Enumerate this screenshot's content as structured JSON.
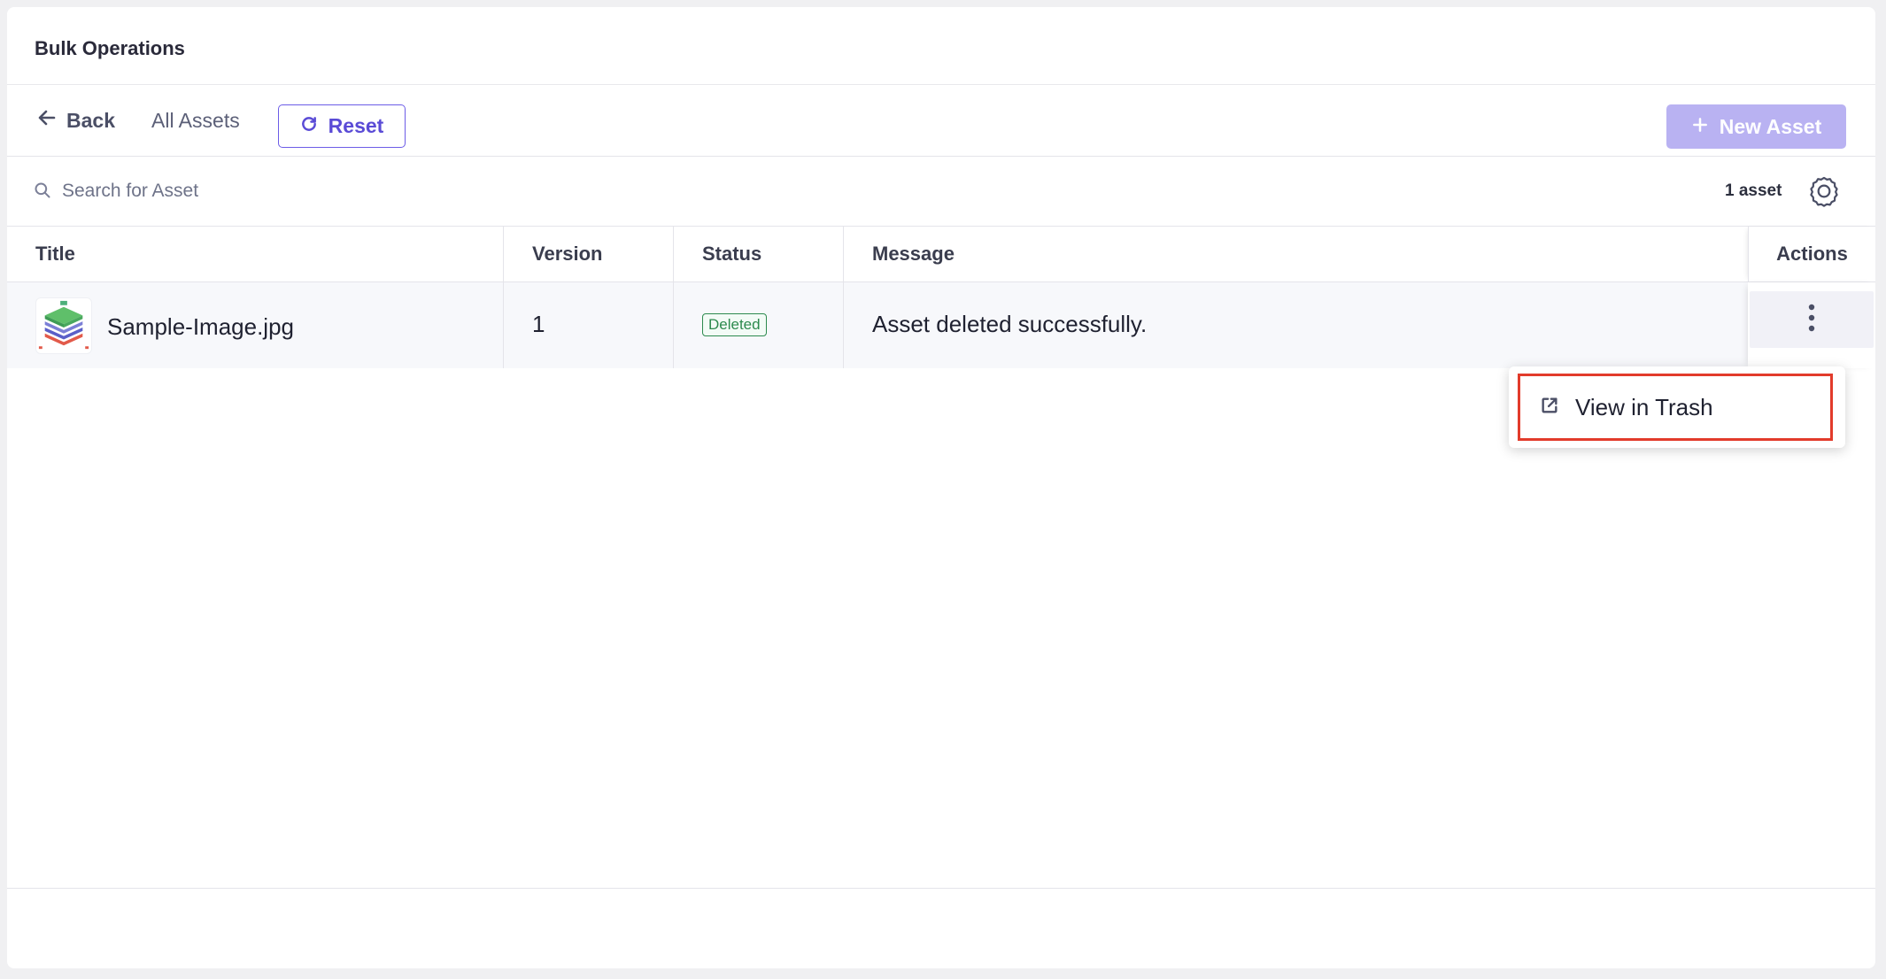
{
  "header": {
    "title": "Bulk Operations"
  },
  "toolbar": {
    "back_label": "Back",
    "all_assets_label": "All Assets",
    "reset_label": "Reset",
    "new_asset_label": "New Asset"
  },
  "search": {
    "placeholder": "Search for Asset",
    "count_label": "1 asset"
  },
  "table": {
    "columns": [
      "Title",
      "Version",
      "Status",
      "Message",
      "Actions"
    ],
    "rows": [
      {
        "title": "Sample-Image.jpg",
        "version": "1",
        "status": "Deleted",
        "message": "Asset deleted successfully."
      }
    ]
  },
  "actions_menu": {
    "items": [
      {
        "label": "View in Trash",
        "icon": "external-link-icon"
      }
    ]
  },
  "colors": {
    "accent": "#6c5ce7",
    "new_asset_disabled": "#b9b2f2",
    "status_deleted": "#2d8a4e",
    "highlight": "#e23b2b"
  }
}
